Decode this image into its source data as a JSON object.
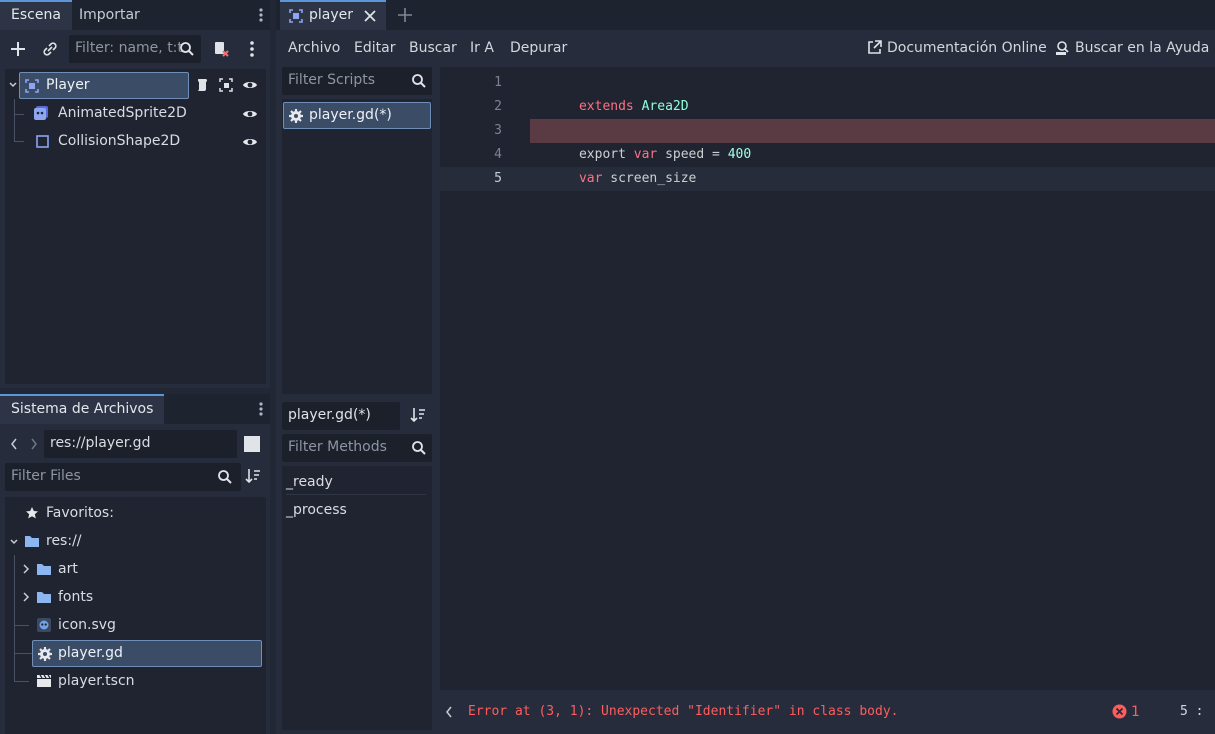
{
  "scene_dock": {
    "tabs": [
      "Escena",
      "Importar"
    ],
    "filter_placeholder": "Filter: name, t:t",
    "tree": [
      {
        "label": "Player",
        "icon": "area2d-icon"
      },
      {
        "label": "AnimatedSprite2D",
        "icon": "animated-sprite-icon"
      },
      {
        "label": "CollisionShape2D",
        "icon": "collision-shape-icon"
      }
    ]
  },
  "filesystem_dock": {
    "tab": "Sistema de Archivos",
    "path": "res://player.gd",
    "filter_placeholder": "Filter Files",
    "favorites_label": "Favoritos:",
    "items": [
      {
        "label": "res://",
        "icon": "folder-icon"
      },
      {
        "label": "art",
        "icon": "folder-icon"
      },
      {
        "label": "fonts",
        "icon": "folder-icon"
      },
      {
        "label": "icon.svg",
        "icon": "godot-icon"
      },
      {
        "label": "player.gd",
        "icon": "gear-icon"
      },
      {
        "label": "player.tscn",
        "icon": "clapperboard-icon"
      }
    ]
  },
  "editor": {
    "tab_title": "player",
    "menu": [
      "Archivo",
      "Editar",
      "Buscar",
      "Ir A",
      "Depurar"
    ],
    "online_docs": "Documentación Online",
    "search_help": "Buscar en la Ayuda",
    "filter_scripts_placeholder": "Filter Scripts",
    "scripts": [
      "player.gd(*)"
    ],
    "current_script": "player.gd(*)",
    "filter_methods_placeholder": "Filter Methods",
    "methods": [
      "_ready",
      "_process"
    ],
    "line_numbers": [
      "1",
      "2",
      "3",
      "4",
      "5"
    ],
    "code": {
      "l1_kw": "extends",
      "l1_type": "Area2D",
      "l3_kw1": "export",
      "l3_kw2": "var",
      "l3_mid": "speed =",
      "l3_num": "400",
      "l4_kw": "var",
      "l4_rest": "screen_size"
    },
    "status_error": "Error at (3, 1): Unexpected \"Identifier\" in class body.",
    "error_count": "1",
    "cursor_pos": "5 :"
  },
  "colors": {
    "accent": "#5b96d9",
    "error": "#ff5d5d",
    "error_line_bg": "#5a3a43",
    "keyword": "#ff7085",
    "type": "#8fffdb"
  }
}
